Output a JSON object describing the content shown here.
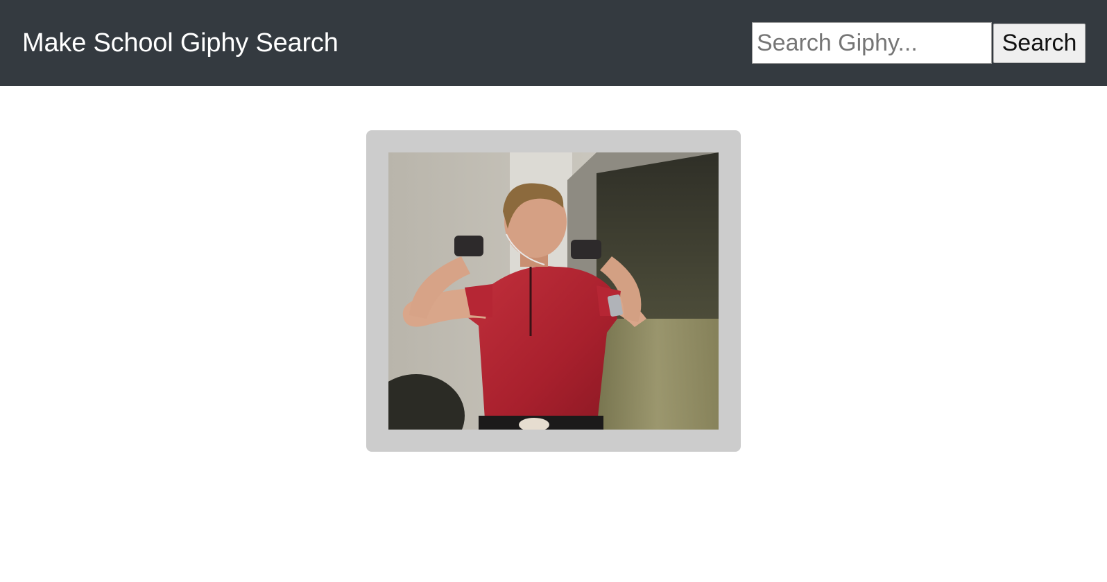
{
  "navbar": {
    "brand": "Make School Giphy Search",
    "background": "#343a40"
  },
  "search": {
    "placeholder": "Search Giphy...",
    "value": "",
    "button_label": "Search"
  },
  "results": {
    "card_color": "#cccccc",
    "gif": {
      "alt": "GIF"
    }
  }
}
